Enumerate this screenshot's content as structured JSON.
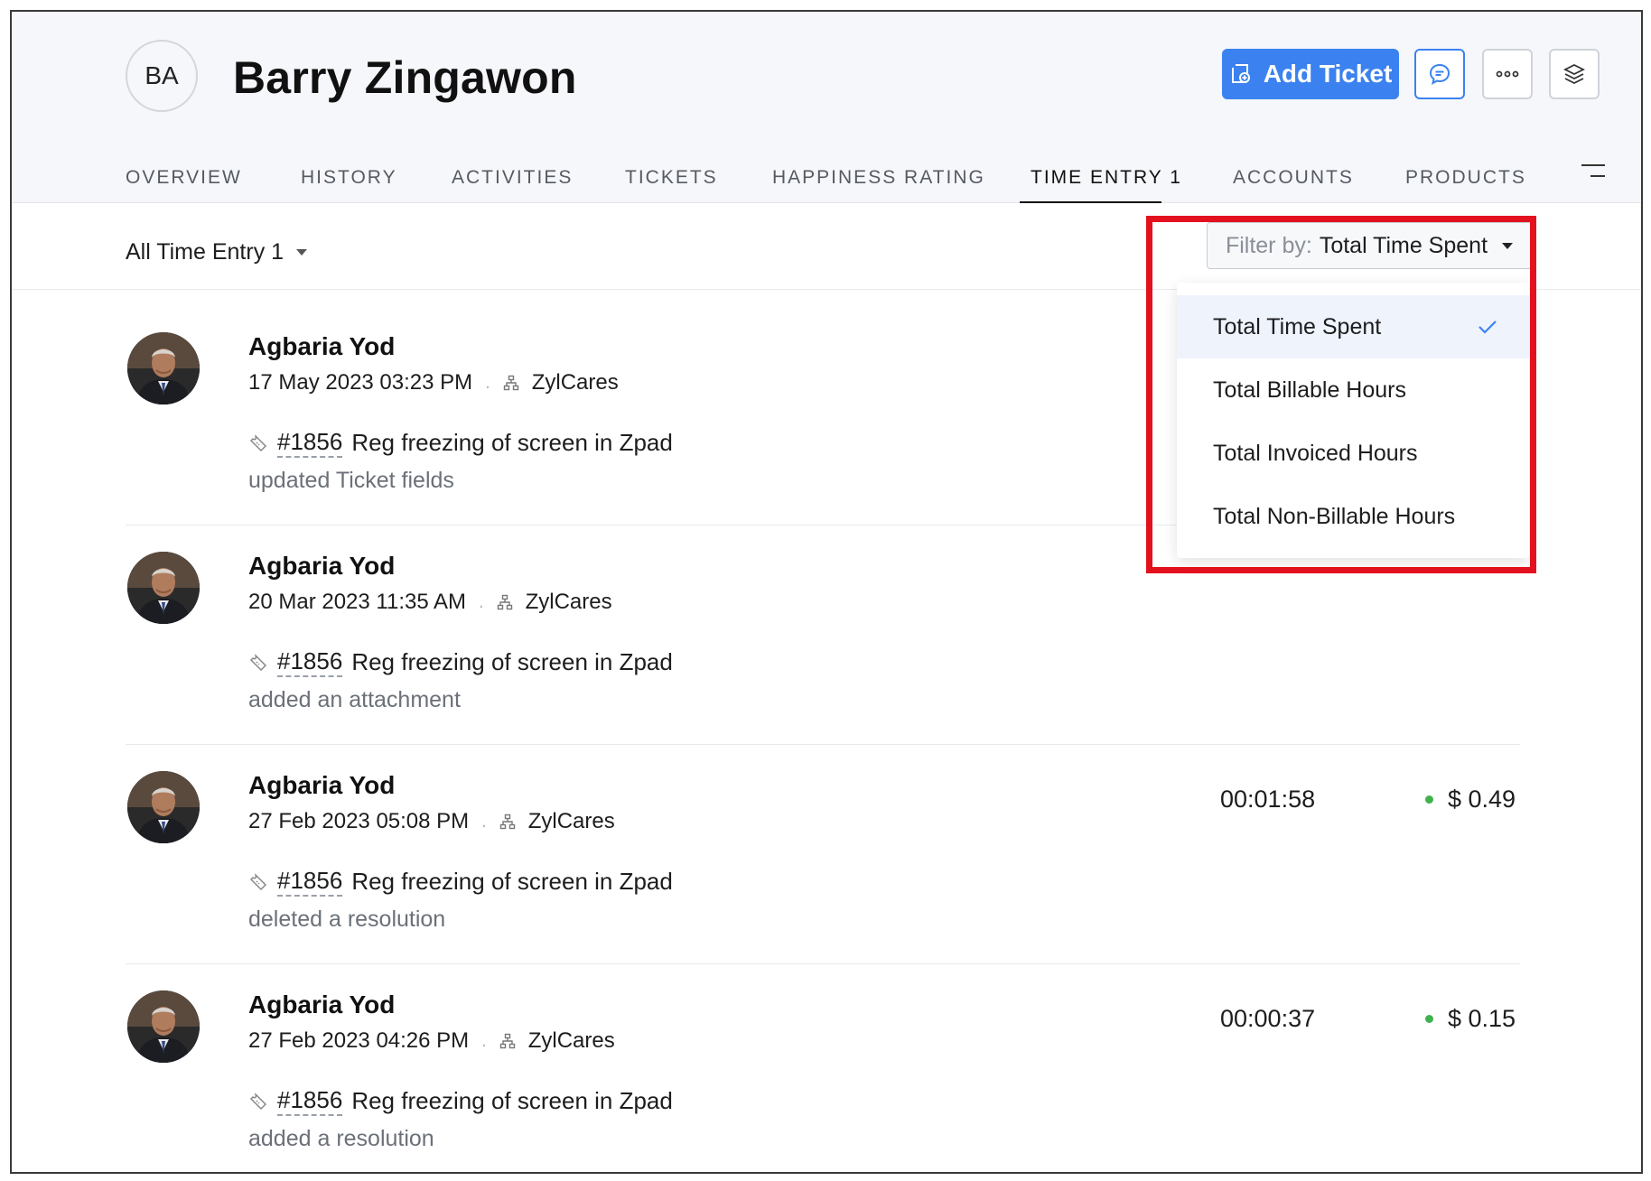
{
  "contact": {
    "initials": "BA",
    "name": "Barry Zingawon"
  },
  "header": {
    "add_ticket_label": "Add Ticket"
  },
  "tabs": [
    {
      "label": "OVERVIEW"
    },
    {
      "label": "HISTORY"
    },
    {
      "label": "ACTIVITIES"
    },
    {
      "label": "TICKETS"
    },
    {
      "label": "HAPPINESS RATING"
    },
    {
      "label": "TIME ENTRY 1"
    },
    {
      "label": "ACCOUNTS"
    },
    {
      "label": "PRODUCTS"
    }
  ],
  "active_tab": "TIME ENTRY 1",
  "view": {
    "label": "All Time Entry 1"
  },
  "filter": {
    "prefix": "Filter by:",
    "value": "Total Time Spent",
    "options": [
      {
        "label": "Total Time Spent",
        "selected": true
      },
      {
        "label": "Total Billable Hours",
        "selected": false
      },
      {
        "label": "Total Invoiced Hours",
        "selected": false
      },
      {
        "label": "Total Non-Billable Hours",
        "selected": false
      }
    ]
  },
  "entries": [
    {
      "name": "Agbaria Yod",
      "datetime": "17 May 2023 03:23 PM",
      "account": "ZylCares",
      "ticket_id": "#1856",
      "ticket_subject": "Reg freezing of screen in Zpad",
      "action": "updated Ticket fields",
      "time": "",
      "amount": ""
    },
    {
      "name": "Agbaria Yod",
      "datetime": "20 Mar 2023 11:35 AM",
      "account": "ZylCares",
      "ticket_id": "#1856",
      "ticket_subject": "Reg freezing of screen in Zpad",
      "action": "added an attachment",
      "time": "",
      "amount": ""
    },
    {
      "name": "Agbaria Yod",
      "datetime": "27 Feb 2023 05:08 PM",
      "account": "ZylCares",
      "ticket_id": "#1856",
      "ticket_subject": "Reg freezing of screen in Zpad",
      "action": "deleted a resolution",
      "time": "00:01:58",
      "amount": "$ 0.49"
    },
    {
      "name": "Agbaria Yod",
      "datetime": "27 Feb 2023 04:26 PM",
      "account": "ZylCares",
      "ticket_id": "#1856",
      "ticket_subject": "Reg freezing of screen in Zpad",
      "action": "added a resolution",
      "time": "00:00:37",
      "amount": "$ 0.15"
    }
  ],
  "colors": {
    "accent": "#3b82f0",
    "highlight": "#e3101d",
    "billable_dot": "#3fb24d"
  }
}
